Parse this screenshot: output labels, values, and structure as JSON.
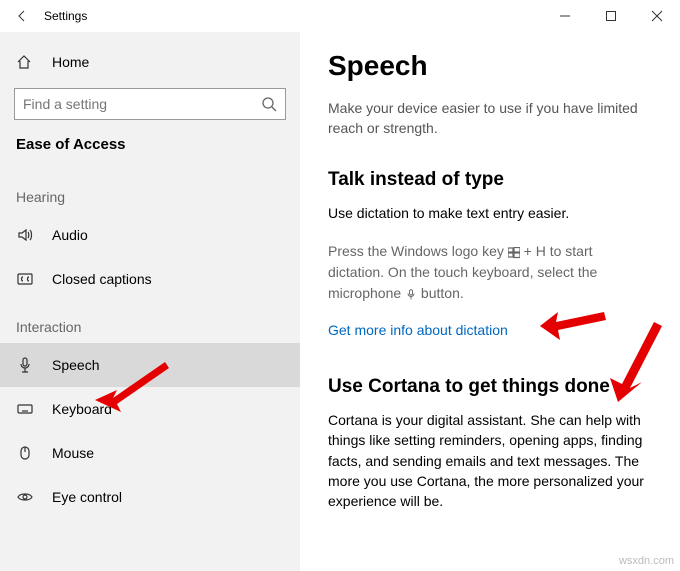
{
  "window": {
    "title": "Settings"
  },
  "sidebar": {
    "home": "Home",
    "search_placeholder": "Find a setting",
    "category": "Ease of Access",
    "groups": {
      "hearing": {
        "label": "Hearing",
        "items": [
          {
            "label": "Audio"
          },
          {
            "label": "Closed captions"
          }
        ]
      },
      "interaction": {
        "label": "Interaction",
        "items": [
          {
            "label": "Speech"
          },
          {
            "label": "Keyboard"
          },
          {
            "label": "Mouse"
          },
          {
            "label": "Eye control"
          }
        ]
      }
    }
  },
  "main": {
    "title": "Speech",
    "subtitle": "Make your device easier to use if you have limited reach or strength.",
    "section1": {
      "heading": "Talk instead of type",
      "line1": "Use dictation to make text entry easier.",
      "line2a": "Press the Windows logo key ",
      "line2b": " + H to start dictation. On the touch keyboard, select the microphone ",
      "line2c": " button.",
      "link": "Get more info about dictation"
    },
    "section2": {
      "heading": "Use Cortana to get things done",
      "body": "Cortana is your digital assistant.  She can help with things like setting reminders, opening apps, finding facts, and sending emails and text messages.  The more you use Cortana, the more personalized your experience will be."
    }
  },
  "watermark": "wsxdn.com"
}
